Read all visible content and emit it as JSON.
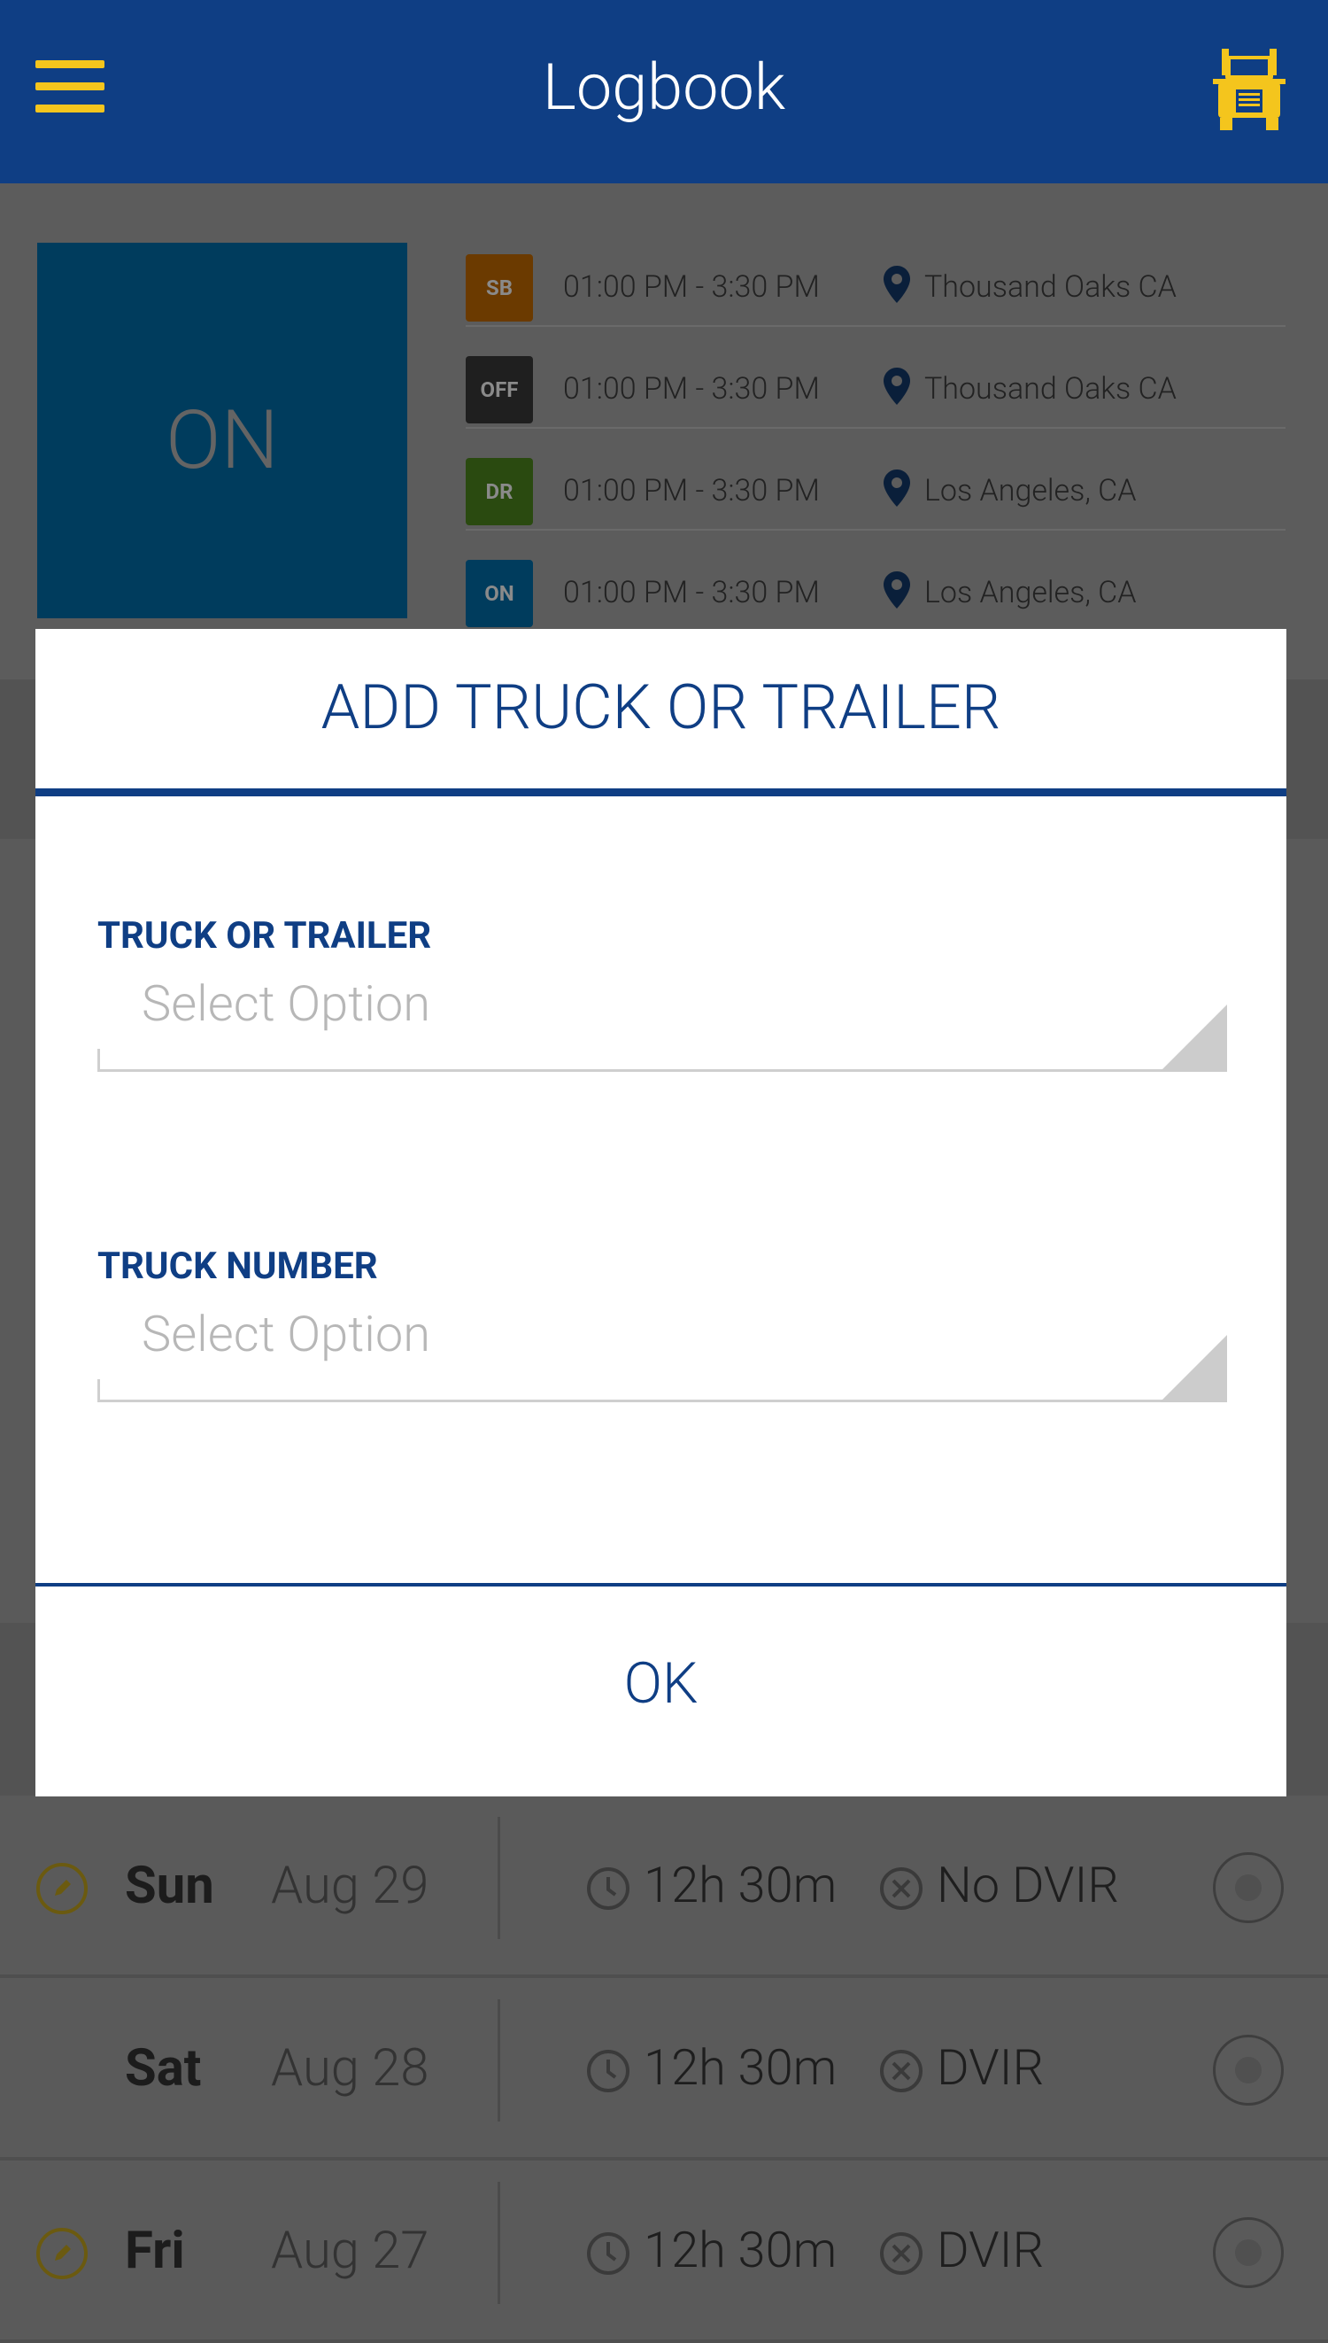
{
  "header": {
    "title": "Logbook",
    "menu_icon": "hamburger-menu-icon",
    "truck_icon": "truck-icon",
    "bg_color": "#0f3e84",
    "accent_color": "#f4c51d"
  },
  "current_status": {
    "label": "ON"
  },
  "log_entries": [
    {
      "code": "SB",
      "time": "01:00 PM - 3:30 PM",
      "location": "Thousand Oaks  CA",
      "color": "#6b3a00"
    },
    {
      "code": "OFF",
      "time": "01:00 PM - 3:30 PM",
      "location": "Thousand Oaks  CA",
      "color": "#1f1f1f"
    },
    {
      "code": "DR",
      "time": "01:00 PM - 3:30 PM",
      "location": "Los Angeles, CA",
      "color": "#2a4a10"
    },
    {
      "code": "ON",
      "time": "01:00 PM - 3:30 PM",
      "location": "Los Angeles, CA",
      "color": "#003c5d"
    }
  ],
  "days": [
    {
      "day": "Sun",
      "date": "Aug 29",
      "hours": "12h 30m",
      "dvir": "No DVIR",
      "editable": true
    },
    {
      "day": "Sat",
      "date": "Aug 28",
      "hours": "12h 30m",
      "dvir": "DVIR",
      "editable": false
    },
    {
      "day": "Fri",
      "date": "Aug 27",
      "hours": "12h 30m",
      "dvir": "DVIR",
      "editable": true
    }
  ],
  "dialog": {
    "title": "ADD TRUCK OR TRAILER",
    "fields": [
      {
        "label": "TRUCK OR TRAILER",
        "placeholder": "Select Option"
      },
      {
        "label": "TRUCK NUMBER",
        "placeholder": "Select Option"
      }
    ],
    "ok_label": "OK"
  }
}
